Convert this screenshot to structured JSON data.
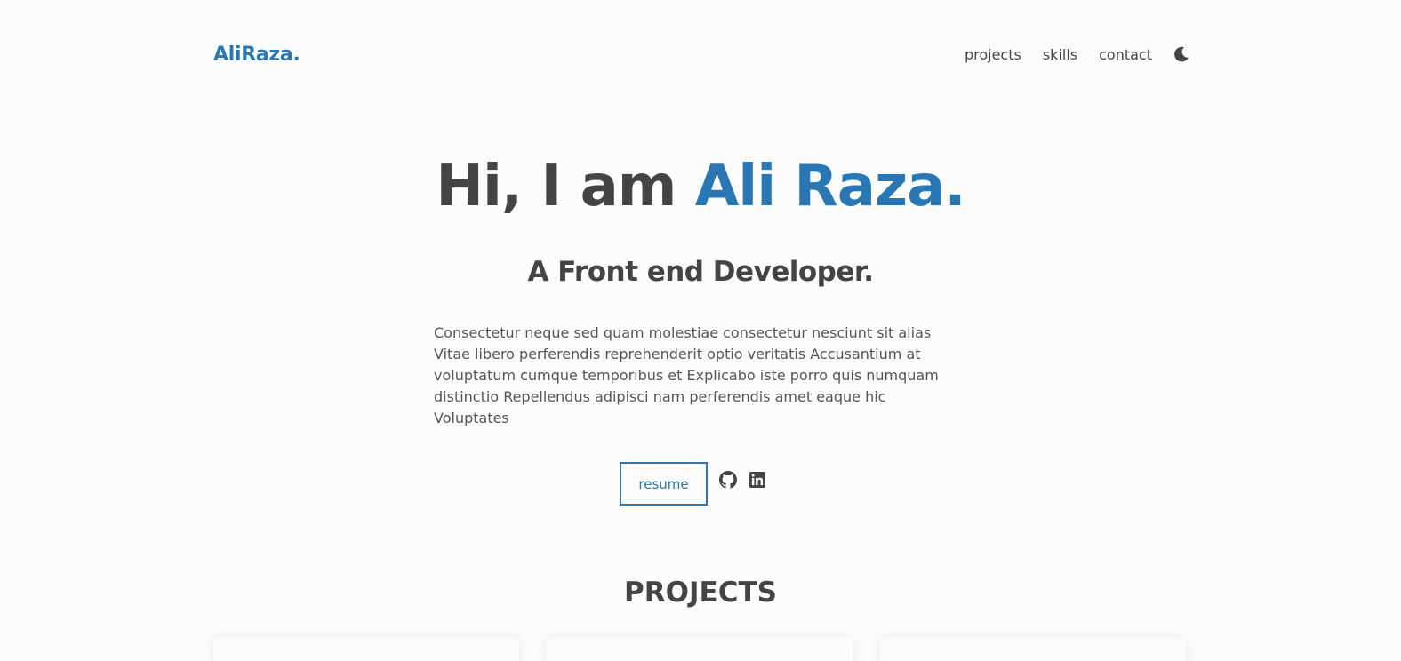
{
  "header": {
    "logo": "AliRaza.",
    "nav": [
      {
        "label": "projects"
      },
      {
        "label": "skills"
      },
      {
        "label": "contact"
      }
    ],
    "theme_toggle_icon": "moon-icon"
  },
  "hero": {
    "title_prefix": "Hi, I am ",
    "title_name": "Ali Raza.",
    "subtitle": "A Front end Developer.",
    "about": "Consectetur neque sed quam molestiae consectetur nesciunt sit alias Vitae libero perferendis reprehenderit optio veritatis Accusantium at voluptatum cumque temporibus et Explicabo iste porro quis numquam distinctio Repellendus adipisci nam perferendis amet eaque hic Voluptates",
    "resume_label": "resume",
    "social_icons": [
      "github-icon",
      "linkedin-icon"
    ]
  },
  "projects": {
    "heading": "PROJECTS"
  },
  "colors": {
    "accent": "#2978b5",
    "text": "#444444",
    "background": "#fcfcfc"
  }
}
